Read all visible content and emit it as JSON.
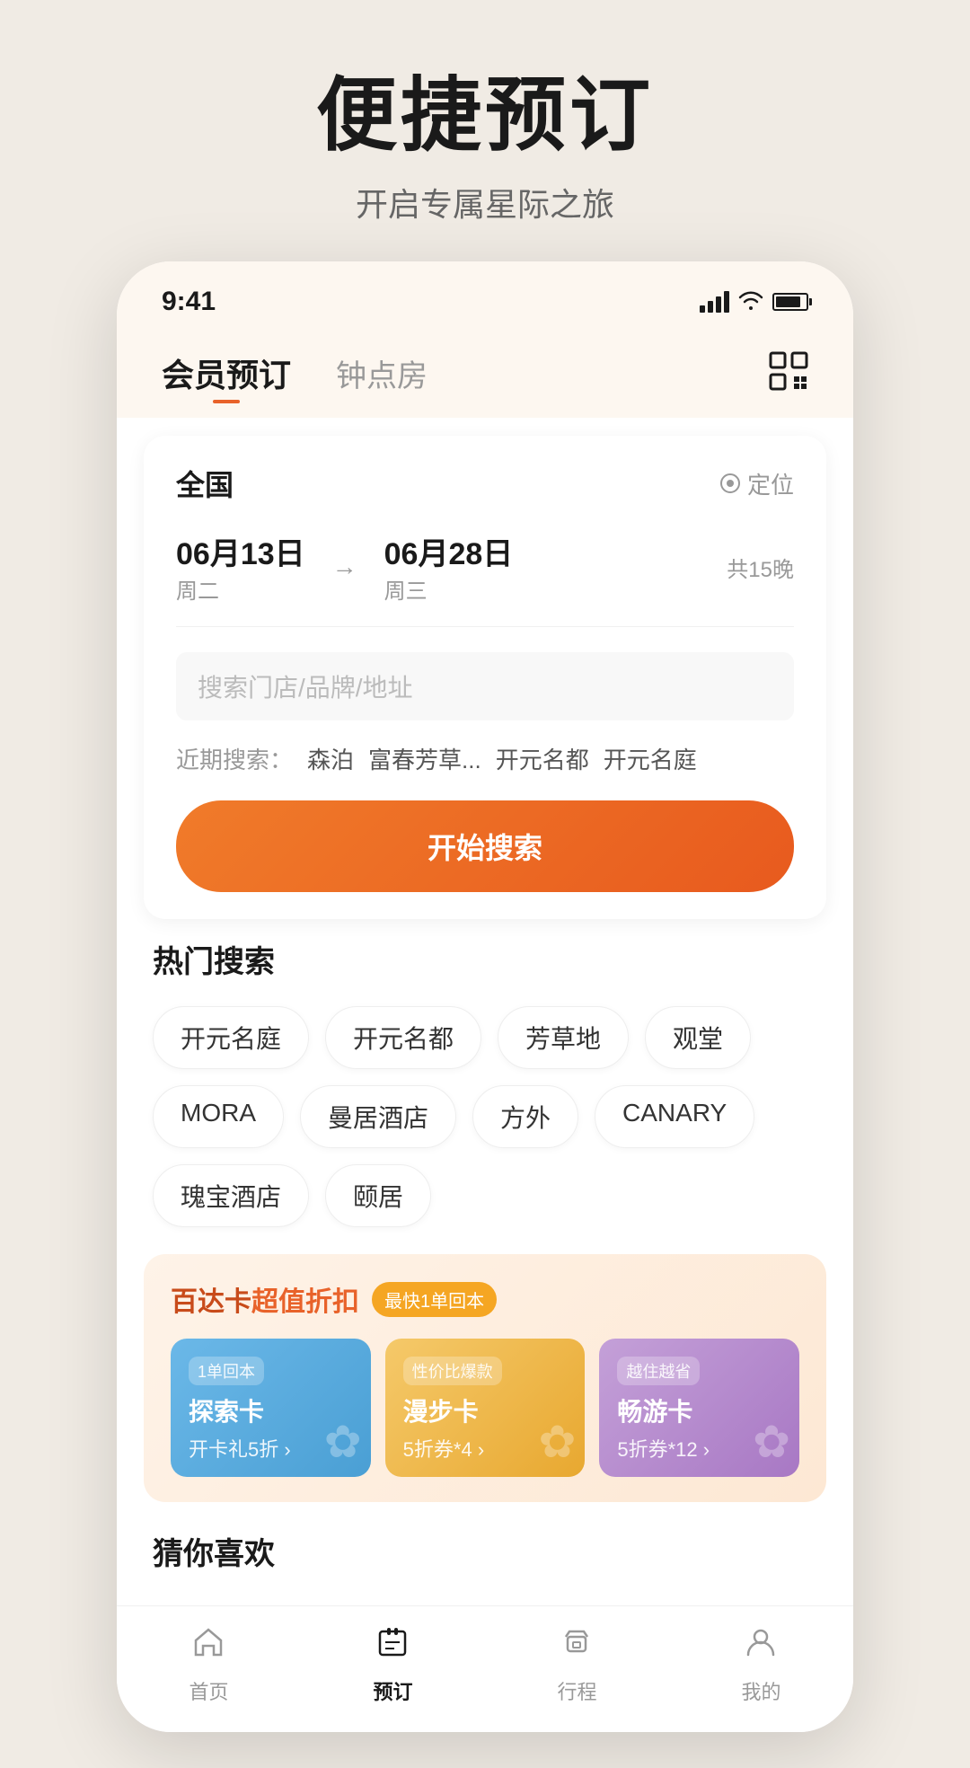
{
  "header": {
    "title": "便捷预订",
    "subtitle": "开启专属星际之旅"
  },
  "statusBar": {
    "time": "9:41"
  },
  "navTabs": {
    "tabs": [
      {
        "label": "会员预订",
        "active": true
      },
      {
        "label": "钟点房",
        "active": false
      }
    ]
  },
  "searchCard": {
    "location": "全国",
    "locationBtn": "定位",
    "dateFrom": "06月13日",
    "dateFromDay": "周二",
    "dateTo": "06月28日",
    "dateToDay": "周三",
    "nights": "共15晚",
    "searchPlaceholder": "搜索门店/品牌/地址",
    "recentLabel": "近期搜索：",
    "recentItems": [
      "森泊",
      "富春芳草...",
      "开元名都",
      "开元名庭"
    ],
    "searchBtn": "开始搜索"
  },
  "hotSearch": {
    "title": "热门搜索",
    "tags": [
      "开元名庭",
      "开元名都",
      "芳草地",
      "观堂",
      "MORA",
      "曼居酒店",
      "方外",
      "CANARY",
      "瑰宝酒店",
      "颐居"
    ]
  },
  "promo": {
    "title": "百达卡",
    "titleHighlight": "超值折扣",
    "badge": "最快1单回本",
    "cards": [
      {
        "badge": "1单回本",
        "name": "探索卡",
        "desc": "开卡礼5折 ›",
        "color": "blue"
      },
      {
        "badge": "性价比爆款",
        "name": "漫步卡",
        "desc": "5折券*4 ›",
        "color": "orange"
      },
      {
        "badge": "越住越省",
        "name": "畅游卡",
        "desc": "5折券*12 ›",
        "color": "purple"
      }
    ]
  },
  "guessYouLike": {
    "title": "猜你喜欢"
  },
  "bottomNav": {
    "items": [
      {
        "label": "首页",
        "icon": "home",
        "active": false
      },
      {
        "label": "预订",
        "icon": "booking",
        "active": true
      },
      {
        "label": "行程",
        "icon": "trip",
        "active": false
      },
      {
        "label": "我的",
        "icon": "profile",
        "active": false
      }
    ]
  }
}
